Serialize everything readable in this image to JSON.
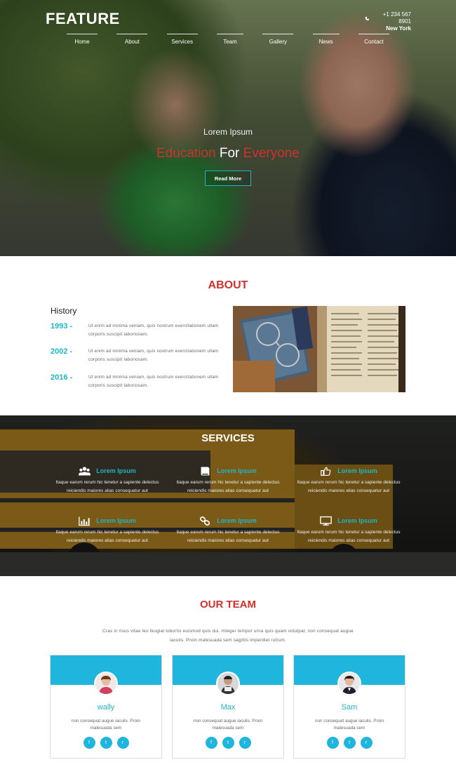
{
  "header": {
    "logo": "FEATURE",
    "phone": "+1 234 567 8901",
    "city": "New York",
    "nav": [
      "Home",
      "About",
      "Services",
      "Team",
      "Gallery",
      "News",
      "Contact"
    ]
  },
  "hero": {
    "subtitle": "Lorem Ipsum",
    "title_part1": "Education",
    "title_part2": "For",
    "title_part3": "Everyone",
    "button": "Read More"
  },
  "about": {
    "title": "ABOUT",
    "history_title": "History",
    "timeline": [
      {
        "year": "1993 -",
        "text": "Ut enim ad minima veniam, quis nostrum exercitationem ullam corporis suscipit laboriosam."
      },
      {
        "year": "2002 -",
        "text": "Ut enim ad minima veniam, quis nostrum exercitationem ullam corporis suscipit laboriosam."
      },
      {
        "year": "2016 -",
        "text": "Ut enim ad minima veniam, quis nostrum exercitationem ullam corporis suscipit laboriosam."
      }
    ]
  },
  "services": {
    "title": "SERVICES",
    "items": [
      {
        "icon": "users-icon",
        "label": "Lorem Ipsum",
        "text": "Itaque earum rerum hic tenetur a sapiente delectus reiciendis maiores alias consequatur aut"
      },
      {
        "icon": "book-icon",
        "label": "Lorem Ipsum",
        "text": "Itaque earum rerum hic tenetur a sapiente delectus reiciendis maiores alias consequatur aut"
      },
      {
        "icon": "thumbs-up-icon",
        "label": "Lorem Ipsum",
        "text": "Itaque earum rerum hic tenetur a sapiente delectus reiciendis maiores alias consequatur aut"
      },
      {
        "icon": "bar-chart-icon",
        "label": "Lorem Ipsum",
        "text": "Itaque earum rerum hic tenetur a sapiente delectus reiciendis maiores alias consequatur aut"
      },
      {
        "icon": "link-icon",
        "label": "Lorem Ipsum",
        "text": "Itaque earum rerum hic tenetur a sapiente delectus reiciendis maiores alias consequatur aut"
      },
      {
        "icon": "monitor-icon",
        "label": "Lorem Ipsum",
        "text": "Itaque earum rerum hic tenetur a sapiente delectus reiciendis maiores alias consequatur aut"
      }
    ]
  },
  "team": {
    "title": "OUR TEAM",
    "intro": "Cras in risus vitae leo feugiat lobortis euismod quis dui. Integer tempor urna quis quam volutpat, non consequat augue iaculis. Proin malesuada sem sagittis imperdiet rutrum.",
    "members": [
      {
        "name": "wally",
        "text": "non consequat augue iaculis. Proin malesuada sem"
      },
      {
        "name": "Max",
        "text": "non consequat augue iaculis. Proin malesuada sem"
      },
      {
        "name": "Sam",
        "text": "non consequat augue iaculis. Proin malesuada sem"
      }
    ],
    "social_icons": [
      "facebook-icon",
      "twitter-icon",
      "rss-icon"
    ]
  },
  "colors": {
    "accent": "#1fb5c5",
    "brand_red": "#d0312d",
    "card_band": "#1fb5dd"
  }
}
